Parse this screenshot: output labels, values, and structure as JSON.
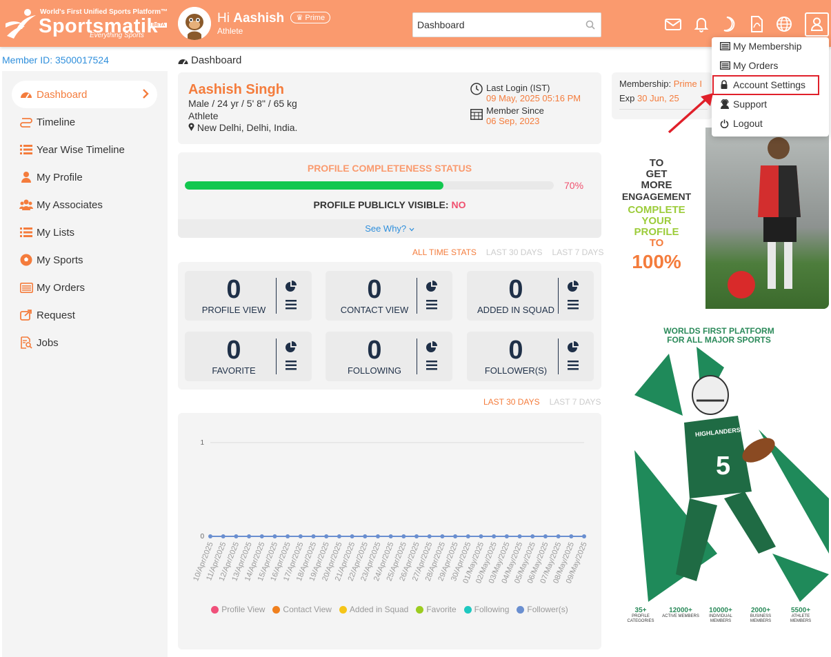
{
  "header": {
    "tagline": "World's First Unified Sports Platform™",
    "brand": "Sportsmatik",
    "beta": "BETA",
    "subtitle": "Everything Sports",
    "greeting_hi": "Hi",
    "user_first": "Aashish",
    "prime_label": "Prime",
    "role": "Athlete",
    "search_value": "Dashboard",
    "search_placeholder": "Search"
  },
  "member_id": "Member ID: 3500017524",
  "sidebar": {
    "items": [
      {
        "label": "Dashboard",
        "icon": "dashboard-icon",
        "active": true
      },
      {
        "label": "Timeline",
        "icon": "timeline-icon"
      },
      {
        "label": "Year Wise Timeline",
        "icon": "list-icon"
      },
      {
        "label": "My Profile",
        "icon": "user-icon"
      },
      {
        "label": "My Associates",
        "icon": "users-icon"
      },
      {
        "label": "My Lists",
        "icon": "list-icon"
      },
      {
        "label": "My Sports",
        "icon": "ball-icon"
      },
      {
        "label": "My Orders",
        "icon": "orders-icon"
      },
      {
        "label": "Request",
        "icon": "request-icon"
      },
      {
        "label": "Jobs",
        "icon": "jobs-icon"
      }
    ]
  },
  "breadcrumb": "Dashboard",
  "profile": {
    "name": "Aashish Singh",
    "details": "Male / 24 yr / 5' 8\" / 65 kg",
    "role": "Athlete",
    "location": "New Delhi, Delhi, India.",
    "last_login_label": "Last Login (IST)",
    "last_login_value": "09 May, 2025 05:16 PM",
    "member_since_label": "Member Since",
    "member_since_value": "06 Sep, 2023"
  },
  "completeness": {
    "title": "PROFILE COMPLETENESS STATUS",
    "percent": 70,
    "percent_label": "70%",
    "visible_label": "PROFILE PUBLICLY VISIBLE:",
    "visible_value": "NO",
    "see_why": "See Why?"
  },
  "stat_tabs": [
    "ALL TIME STATS",
    "LAST 30 DAYS",
    "LAST 7 DAYS"
  ],
  "stats": [
    {
      "value": "0",
      "label": "PROFILE VIEW"
    },
    {
      "value": "0",
      "label": "CONTACT VIEW"
    },
    {
      "value": "0",
      "label": "ADDED IN SQUAD"
    },
    {
      "value": "0",
      "label": "FAVORITE"
    },
    {
      "value": "0",
      "label": "FOLLOWING"
    },
    {
      "value": "0",
      "label": "FOLLOWER(S)"
    }
  ],
  "chart_tabs": [
    "LAST 30 DAYS",
    "LAST 7 DAYS"
  ],
  "chart_data": {
    "type": "line",
    "ylim": [
      0,
      1
    ],
    "yticks": [
      "0",
      "1"
    ],
    "x": [
      "10/Apr/2025",
      "11/Apr/2025",
      "12/Apr/2025",
      "13/Apr/2025",
      "14/Apr/2025",
      "15/Apr/2025",
      "16/Apr/2025",
      "17/Apr/2025",
      "18/Apr/2025",
      "19/Apr/2025",
      "20/Apr/2025",
      "21/Apr/2025",
      "22/Apr/2025",
      "23/Apr/2025",
      "24/Apr/2025",
      "25/Apr/2025",
      "26/Apr/2025",
      "27/Apr/2025",
      "28/Apr/2025",
      "29/Apr/2025",
      "30/Apr/2025",
      "01/May/2025",
      "02/May/2025",
      "03/May/2025",
      "04/May/2025",
      "05/May/2025",
      "06/May/2025",
      "07/May/2025",
      "08/May/2025",
      "09/May/2025"
    ],
    "series": [
      {
        "name": "Profile View",
        "color": "#f0507a",
        "values": [
          0,
          0,
          0,
          0,
          0,
          0,
          0,
          0,
          0,
          0,
          0,
          0,
          0,
          0,
          0,
          0,
          0,
          0,
          0,
          0,
          0,
          0,
          0,
          0,
          0,
          0,
          0,
          0,
          0,
          0
        ]
      },
      {
        "name": "Contact View",
        "color": "#f0801e",
        "values": [
          0,
          0,
          0,
          0,
          0,
          0,
          0,
          0,
          0,
          0,
          0,
          0,
          0,
          0,
          0,
          0,
          0,
          0,
          0,
          0,
          0,
          0,
          0,
          0,
          0,
          0,
          0,
          0,
          0,
          0
        ]
      },
      {
        "name": "Added in Squad",
        "color": "#f5c518",
        "values": [
          0,
          0,
          0,
          0,
          0,
          0,
          0,
          0,
          0,
          0,
          0,
          0,
          0,
          0,
          0,
          0,
          0,
          0,
          0,
          0,
          0,
          0,
          0,
          0,
          0,
          0,
          0,
          0,
          0,
          0
        ]
      },
      {
        "name": "Favorite",
        "color": "#9ccc20",
        "values": [
          0,
          0,
          0,
          0,
          0,
          0,
          0,
          0,
          0,
          0,
          0,
          0,
          0,
          0,
          0,
          0,
          0,
          0,
          0,
          0,
          0,
          0,
          0,
          0,
          0,
          0,
          0,
          0,
          0,
          0
        ]
      },
      {
        "name": "Following",
        "color": "#1ec8c0",
        "values": [
          0,
          0,
          0,
          0,
          0,
          0,
          0,
          0,
          0,
          0,
          0,
          0,
          0,
          0,
          0,
          0,
          0,
          0,
          0,
          0,
          0,
          0,
          0,
          0,
          0,
          0,
          0,
          0,
          0,
          0
        ]
      },
      {
        "name": "Follower(s)",
        "color": "#6a8fd0",
        "values": [
          0,
          0,
          0,
          0,
          0,
          0,
          0,
          0,
          0,
          0,
          0,
          0,
          0,
          0,
          0,
          0,
          0,
          0,
          0,
          0,
          0,
          0,
          0,
          0,
          0,
          0,
          0,
          0,
          0,
          0
        ]
      }
    ]
  },
  "membership": {
    "label": "Membership:",
    "value": "Prime I",
    "exp_label": "Exp",
    "exp_value": "30 Jun, 25"
  },
  "ad1": {
    "lines": [
      "TO",
      "GET",
      "MORE",
      "ENGAGEMENT",
      "COMPLETE",
      "YOUR",
      "PROFILE",
      "TO",
      "100%"
    ]
  },
  "ad2": {
    "title": "WORLDS FIRST PLATFORM FOR ALL MAJOR SPORTS",
    "jersey": "5",
    "team": "HIGHLANDERS",
    "stats": [
      {
        "value": "35+",
        "label": "PROFILE CATEGORIES"
      },
      {
        "value": "12000+",
        "label": "ACTIVE MEMBERS"
      },
      {
        "value": "10000+",
        "label": "INDIVIDUAL MEMBERS"
      },
      {
        "value": "2000+",
        "label": "BUSINESS MEMBERS"
      },
      {
        "value": "5500+",
        "label": "ATHLETE MEMBERS"
      }
    ]
  },
  "dropdown": {
    "items": [
      "My Membership",
      "My Orders",
      "Account Settings",
      "Support",
      "Logout"
    ]
  },
  "colors": {
    "header": "#fa9a6e",
    "accent": "#f47c3c",
    "link": "#2f8fdc",
    "progress": "#12c74f",
    "alert": "#f0506e",
    "highlight": "#e0202a"
  }
}
